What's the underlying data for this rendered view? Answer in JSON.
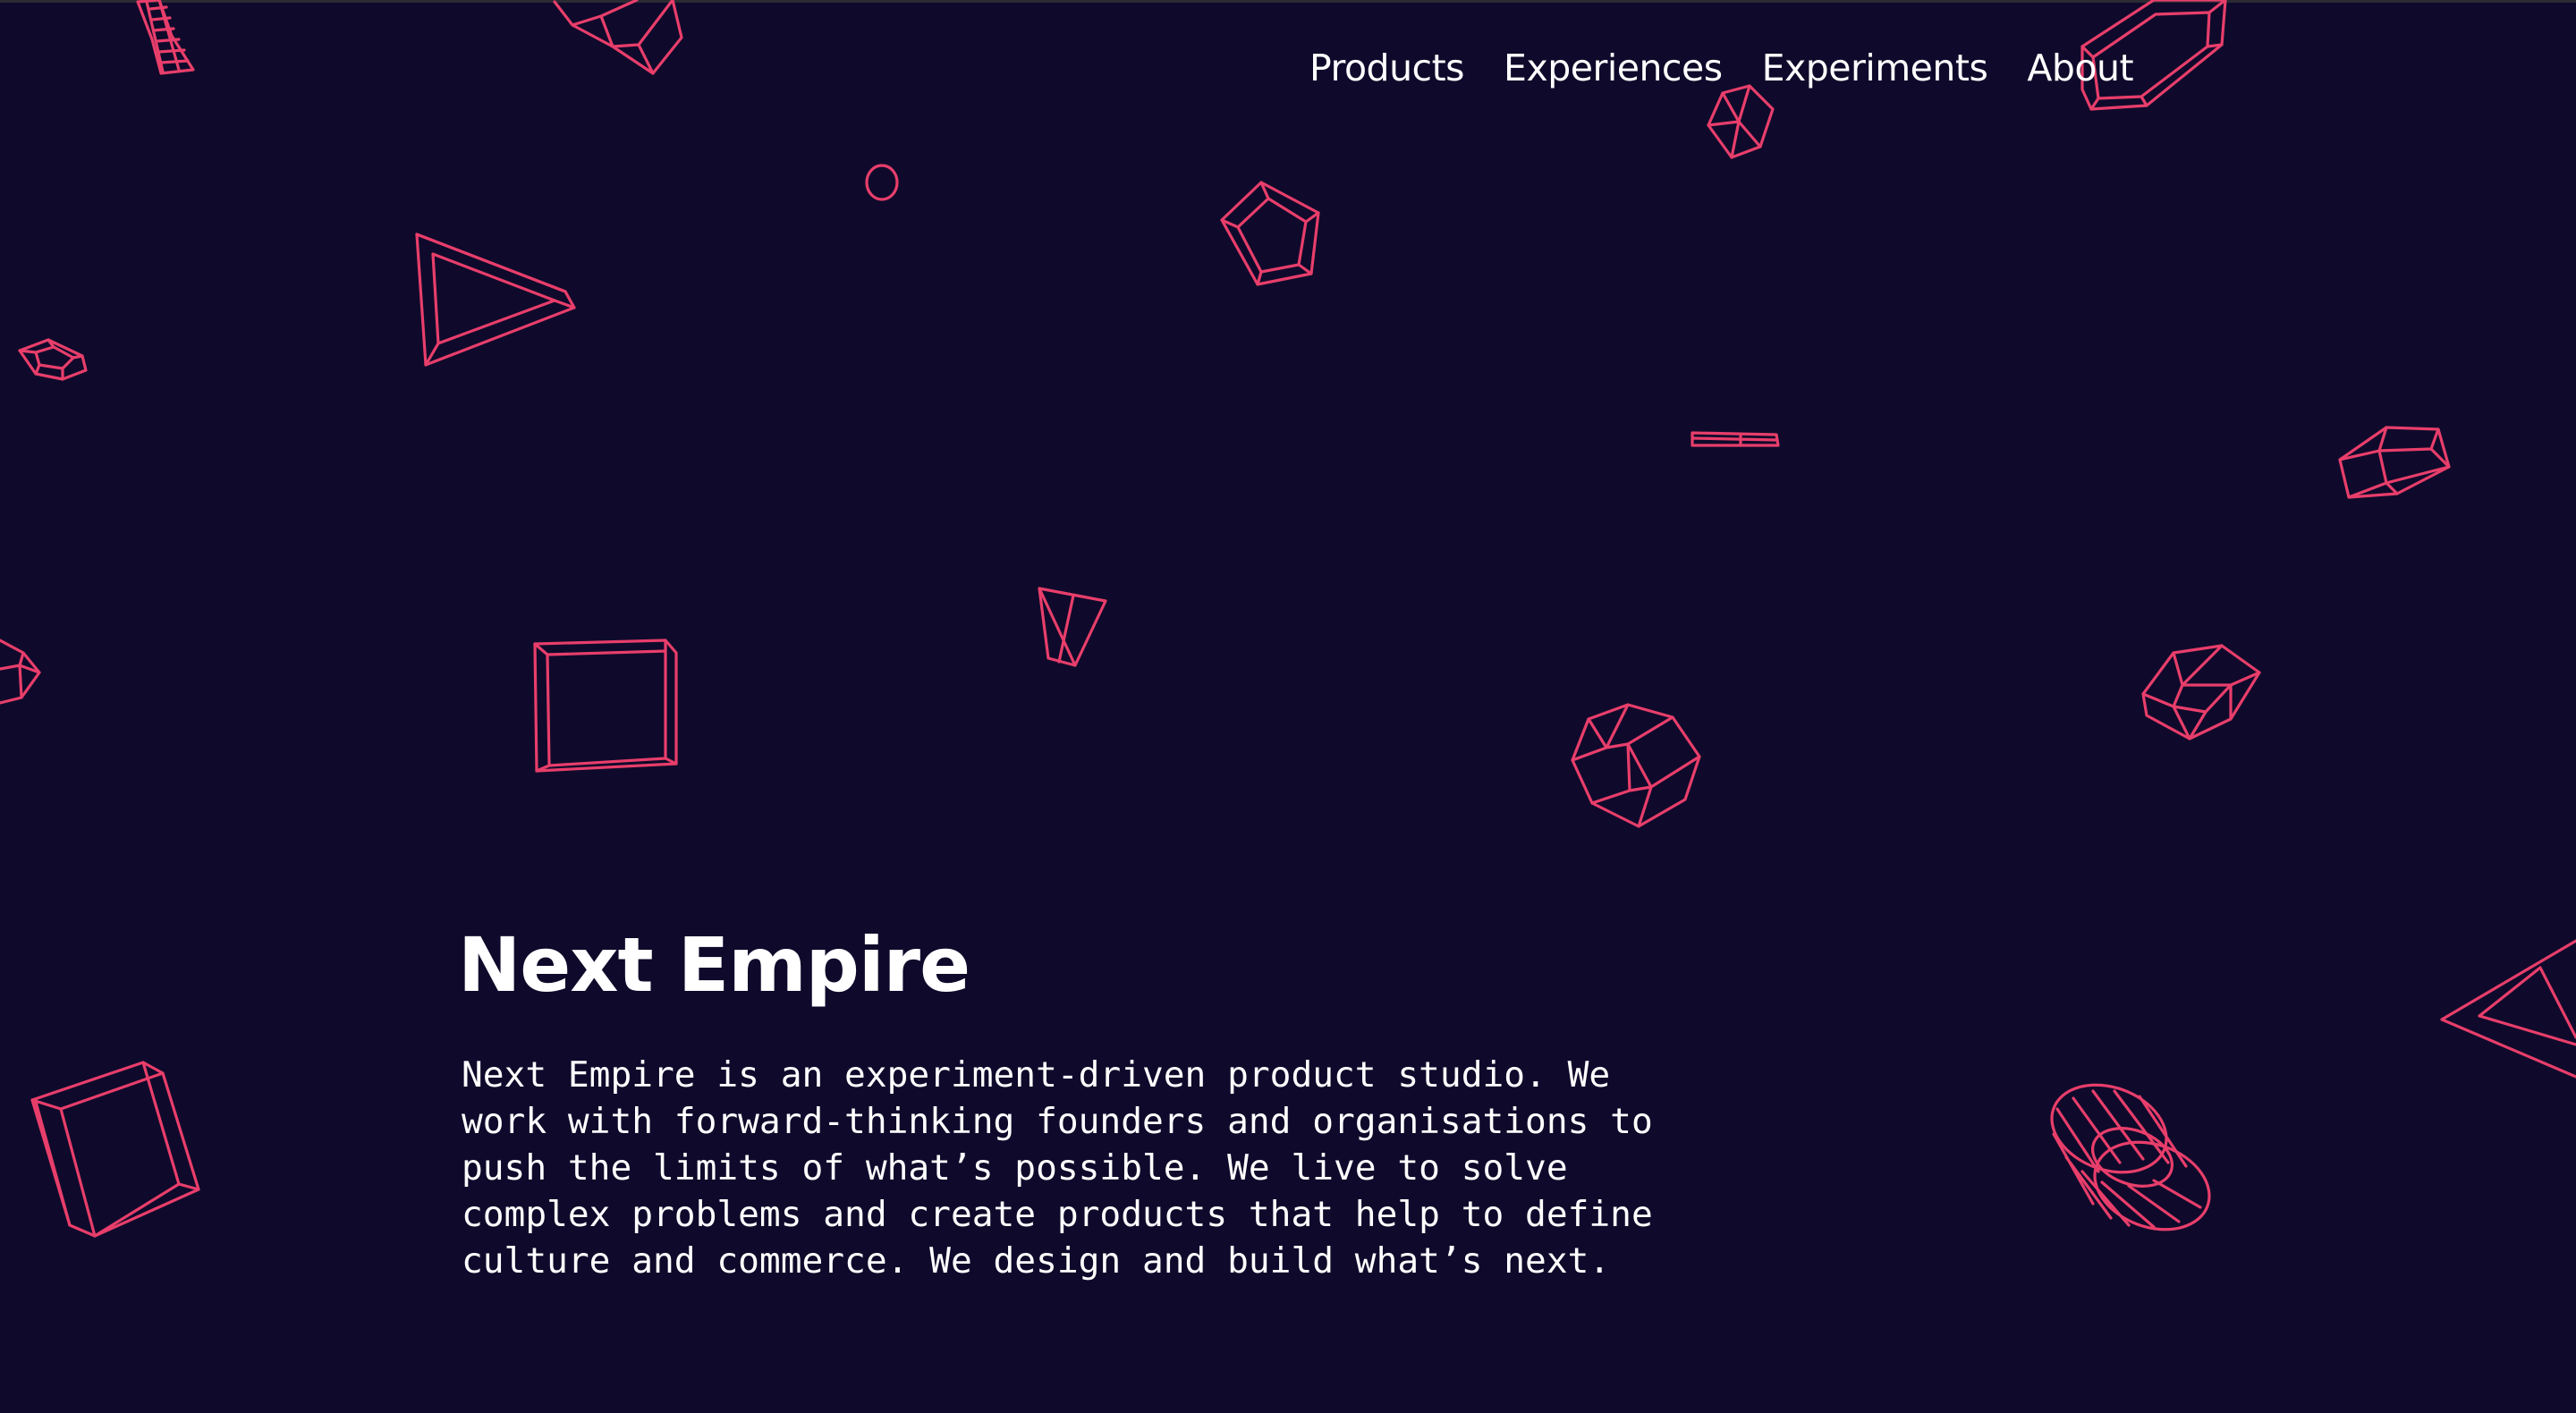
{
  "nav": {
    "items": [
      {
        "label": "Products"
      },
      {
        "label": "Experiences"
      },
      {
        "label": "Experiments"
      },
      {
        "label": "About"
      }
    ]
  },
  "hero": {
    "title": "Next Empire",
    "body": "Next Empire is an experiment-driven product studio. We\nwork with forward-thinking founders and organisations to\npush the limits of what’s possible. We live to solve\ncomplex problems and create products that help to define\nculture and commerce. We design and build what’s next."
  },
  "colors": {
    "background": "#0f0a2b",
    "accent": "#e83e6b",
    "text": "#ffffff"
  }
}
